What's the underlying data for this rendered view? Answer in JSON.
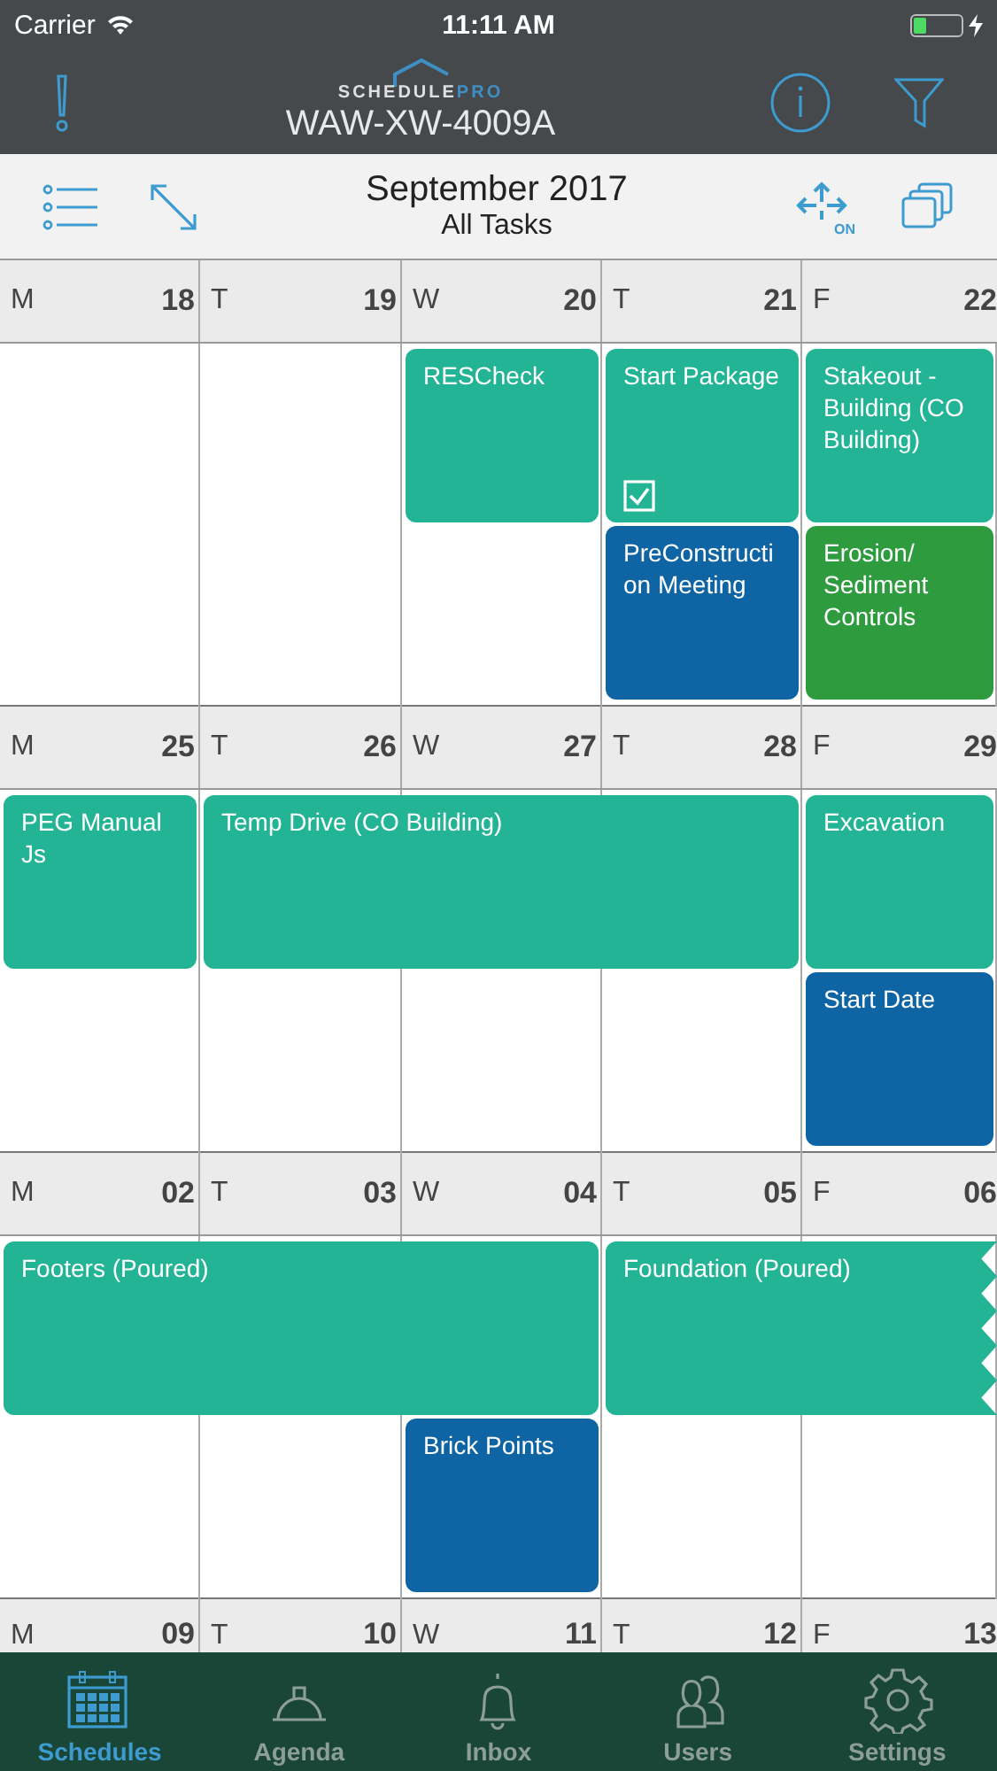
{
  "status_bar": {
    "carrier": "Carrier",
    "time": "11:11 AM"
  },
  "nav_bar": {
    "logo": {
      "first": "SCHEDULE",
      "second": "PRO"
    },
    "title": "WAW-XW-4009A"
  },
  "toolbar": {
    "title": "September 2017",
    "subtitle": "All Tasks",
    "move_toggle": "ON"
  },
  "weeks": [
    {
      "days": [
        {
          "letter": "M",
          "date": "18"
        },
        {
          "letter": "T",
          "date": "19"
        },
        {
          "letter": "W",
          "date": "20"
        },
        {
          "letter": "T",
          "date": "21"
        },
        {
          "letter": "F",
          "date": "22"
        }
      ],
      "lanes": [
        [
          {
            "kind": "empty"
          },
          {
            "kind": "empty"
          },
          {
            "kind": "event",
            "title": "RESCheck",
            "color": "#22b494",
            "completed": false,
            "continues": false
          },
          {
            "kind": "event",
            "title": "Start Package",
            "color": "#22b494",
            "completed": true,
            "continues": false
          },
          {
            "kind": "event",
            "title": "Stakeout - Building (CO Building)",
            "color": "#22b494",
            "completed": false,
            "continues": false
          }
        ],
        [
          {
            "kind": "empty"
          },
          {
            "kind": "empty"
          },
          {
            "kind": "empty"
          },
          {
            "kind": "event",
            "title": "PreConstruction Meeting",
            "color": "#0f65a3",
            "completed": false,
            "continues": false
          },
          {
            "kind": "event",
            "title": "Erosion/ Sediment Controls",
            "color": "#2e9c3e",
            "completed": false,
            "continues": false
          }
        ]
      ]
    },
    {
      "days": [
        {
          "letter": "M",
          "date": "25"
        },
        {
          "letter": "T",
          "date": "26"
        },
        {
          "letter": "W",
          "date": "27"
        },
        {
          "letter": "T",
          "date": "28"
        },
        {
          "letter": "F",
          "date": "29"
        }
      ],
      "lanes": [
        [
          {
            "kind": "event",
            "title": "PEG Manual Js",
            "color": "#22b494",
            "completed": false,
            "continues": false
          },
          {
            "kind": "event",
            "title": "Temp Drive (CO Building)",
            "color": "#22b494",
            "completed": false,
            "continues": false
          },
          {
            "kind": "continued"
          },
          {
            "kind": "continued"
          },
          {
            "kind": "event",
            "title": "Excavation",
            "color": "#22b494",
            "completed": false,
            "continues": false
          }
        ],
        [
          {
            "kind": "empty"
          },
          {
            "kind": "empty"
          },
          {
            "kind": "empty"
          },
          {
            "kind": "empty"
          },
          {
            "kind": "event",
            "title": "Start Date",
            "color": "#0f65a3",
            "completed": false,
            "continues": false
          }
        ]
      ]
    },
    {
      "days": [
        {
          "letter": "M",
          "date": "02"
        },
        {
          "letter": "T",
          "date": "03"
        },
        {
          "letter": "W",
          "date": "04"
        },
        {
          "letter": "T",
          "date": "05"
        },
        {
          "letter": "F",
          "date": "06"
        }
      ],
      "lanes": [
        [
          {
            "kind": "event",
            "title": "Footers (Poured)",
            "color": "#22b494",
            "completed": false,
            "continues": false
          },
          {
            "kind": "continued"
          },
          {
            "kind": "continued"
          },
          {
            "kind": "event",
            "title": "Foundation (Poured)",
            "color": "#22b494",
            "completed": false,
            "continues": true
          },
          {
            "kind": "continued"
          }
        ],
        [
          {
            "kind": "empty"
          },
          {
            "kind": "empty"
          },
          {
            "kind": "event",
            "title": "Brick Points",
            "color": "#0f65a3",
            "completed": false,
            "continues": false
          },
          {
            "kind": "empty"
          },
          {
            "kind": "empty"
          }
        ]
      ]
    },
    {
      "days": [
        {
          "letter": "M",
          "date": "09"
        },
        {
          "letter": "T",
          "date": "10"
        },
        {
          "letter": "W",
          "date": "11"
        },
        {
          "letter": "T",
          "date": "12"
        },
        {
          "letter": "F",
          "date": "13"
        }
      ]
    }
  ],
  "tab_bar": [
    {
      "label": "Schedules",
      "selected": true
    },
    {
      "label": "Agenda",
      "selected": false
    },
    {
      "label": "Inbox",
      "selected": false
    },
    {
      "label": "Users",
      "selected": false
    },
    {
      "label": "Settings",
      "selected": false
    }
  ]
}
